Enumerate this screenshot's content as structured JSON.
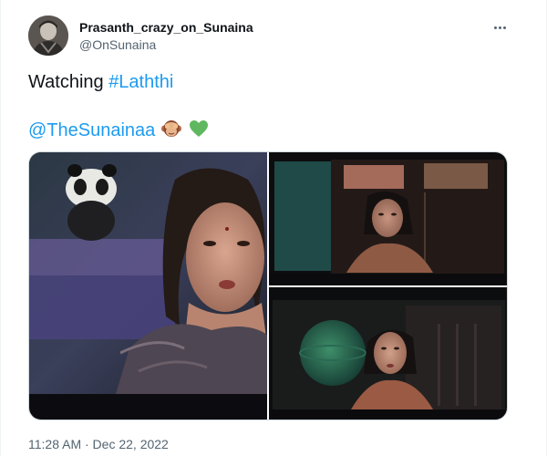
{
  "author": {
    "display_name": "Prasanth_crazy_on_Sunaina",
    "handle": "@OnSunaina",
    "avatar_icon": "profile-avatar"
  },
  "tweet": {
    "text_prefix": "Watching ",
    "hashtag": "#Laththi",
    "mention": "@TheSunainaa",
    "emojis": [
      "see-no-evil-monkey-emoji",
      "green-heart-emoji"
    ]
  },
  "media": [
    {
      "name": "movie-still-1"
    },
    {
      "name": "movie-still-2"
    },
    {
      "name": "movie-still-3"
    }
  ],
  "footer": {
    "timestamp": "11:28 AM · Dec 22, 2022"
  },
  "colors": {
    "link": "#1d9bf0",
    "secondary_text": "#536471",
    "primary_text": "#0f1419",
    "heart": "#5fb85f"
  }
}
